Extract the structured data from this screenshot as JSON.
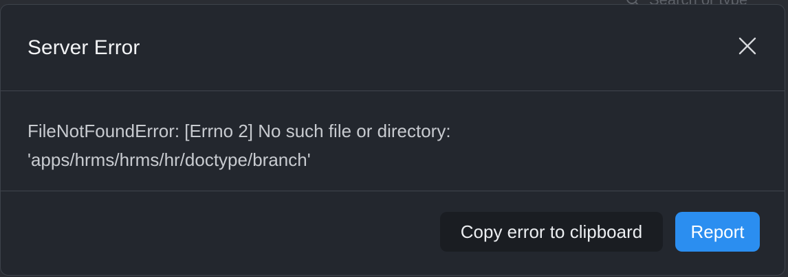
{
  "background": {
    "search_placeholder": "Search or type"
  },
  "dialog": {
    "title": "Server Error",
    "close_icon": "close-icon",
    "message_line_1": "FileNotFoundError: [Errno 2] No such file or directory:",
    "message_line_2": "'apps/hrms/hrms/hr/doctype/branch'",
    "copy_button_label": "Copy error to clipboard",
    "report_button_label": "Report"
  },
  "colors": {
    "accent": "#2b8ef0",
    "dialog_bg": "#23272e",
    "text_primary": "#f2f3f5",
    "text_secondary": "#c8cbd0"
  }
}
